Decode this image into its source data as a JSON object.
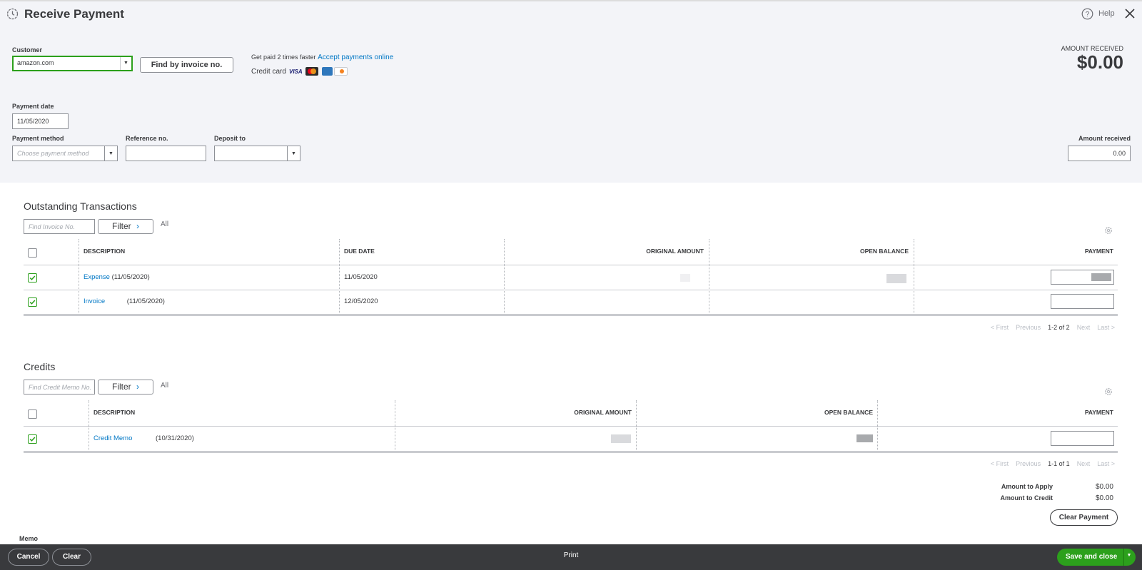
{
  "header": {
    "title": "Receive Payment",
    "help": "Help"
  },
  "customer": {
    "label": "Customer",
    "value": "amazon.com",
    "find_button": "Find by invoice no."
  },
  "promo": {
    "text": "Get paid 2 times faster",
    "link": "Accept payments online",
    "credit_card_label": "Credit card"
  },
  "amount_received_summary": {
    "label": "AMOUNT RECEIVED",
    "value": "$0.00"
  },
  "payment_date": {
    "label": "Payment date",
    "value": "11/05/2020"
  },
  "payment_method": {
    "label": "Payment method",
    "placeholder": "Choose payment method"
  },
  "reference_no": {
    "label": "Reference no.",
    "value": ""
  },
  "deposit_to": {
    "label": "Deposit to",
    "value": ""
  },
  "amount_received": {
    "label": "Amount received",
    "value": "0.00"
  },
  "outstanding": {
    "title": "Outstanding Transactions",
    "search_placeholder": "Find Invoice No.",
    "filter_label": "Filter",
    "filter_value": "All",
    "columns": [
      "DESCRIPTION",
      "DUE DATE",
      "ORIGINAL AMOUNT",
      "OPEN BALANCE",
      "PAYMENT"
    ],
    "rows": [
      {
        "type": "Expense",
        "date": "(11/05/2020)",
        "due": "11/05/2020",
        "checked": true
      },
      {
        "type": "Invoice",
        "date": "(11/05/2020)",
        "due": "12/05/2020",
        "checked": true
      }
    ],
    "pager": {
      "first": "< First",
      "previous": "Previous",
      "range": "1-2 of 2",
      "next": "Next",
      "last": "Last >"
    }
  },
  "credits": {
    "title": "Credits",
    "search_placeholder": "Find Credit Memo No.",
    "filter_label": "Filter",
    "filter_value": "All",
    "columns": [
      "DESCRIPTION",
      "ORIGINAL AMOUNT",
      "OPEN BALANCE",
      "PAYMENT"
    ],
    "rows": [
      {
        "type": "Credit Memo",
        "date": "(10/31/2020)",
        "checked": true
      }
    ],
    "pager": {
      "first": "< First",
      "previous": "Previous",
      "range": "1-1 of 1",
      "next": "Next",
      "last": "Last >"
    }
  },
  "totals": {
    "apply_label": "Amount to Apply",
    "apply_value": "$0.00",
    "credit_label": "Amount to Credit",
    "credit_value": "$0.00",
    "clear_payment": "Clear Payment"
  },
  "memo": {
    "label": "Memo"
  },
  "footer": {
    "cancel": "Cancel",
    "clear": "Clear",
    "print": "Print",
    "save": "Save and close"
  },
  "colors": {
    "accent_green": "#2ca01c",
    "link_blue": "#0077c5",
    "footer_bg": "#393a3d"
  }
}
